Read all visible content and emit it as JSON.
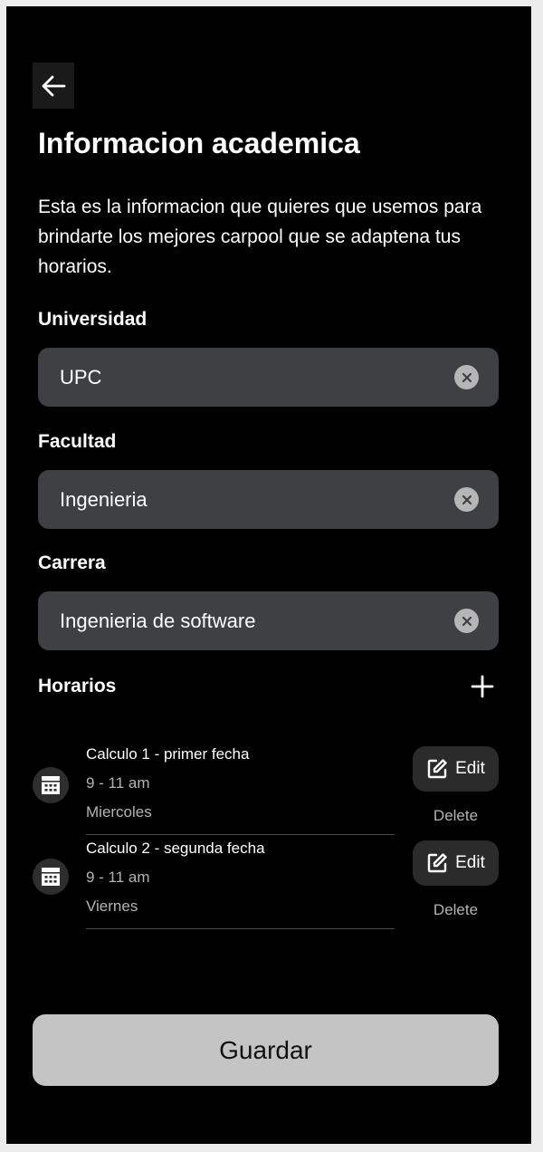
{
  "header": {
    "back_icon": "arrow-left-icon",
    "title": "Informacion academica"
  },
  "description": "Esta es la informacion que quieres que usemos para brindarte los mejores carpool que se adaptena tus horarios.",
  "fields": [
    {
      "label": "Universidad",
      "value": "UPC",
      "clear_icon": "clear-icon"
    },
    {
      "label": "Facultad",
      "value": "Ingenieria",
      "clear_icon": "clear-icon"
    },
    {
      "label": "Carrera",
      "value": "Ingenieria de software",
      "clear_icon": "clear-icon"
    }
  ],
  "schedules": {
    "title": "Horarios",
    "add_icon": "plus-icon",
    "items": [
      {
        "icon": "calendar-icon",
        "title": "Calculo 1 - primer fecha",
        "time": "9 - 11 am",
        "day": "Miercoles",
        "edit_label": "Edit",
        "edit_icon": "edit-icon",
        "delete_label": "Delete"
      },
      {
        "icon": "calendar-icon",
        "title": "Calculo 2 - segunda fecha",
        "time": "9 - 11 am",
        "day": "Viernes",
        "edit_label": "Edit",
        "edit_icon": "edit-icon",
        "delete_label": "Delete"
      }
    ]
  },
  "save_label": "Guardar",
  "colors": {
    "background": "#000000",
    "input_background": "#3f4044",
    "save_button": "#c4c4c4",
    "edit_button": "#2b2b2b",
    "muted_text": "#b3b3b3"
  }
}
